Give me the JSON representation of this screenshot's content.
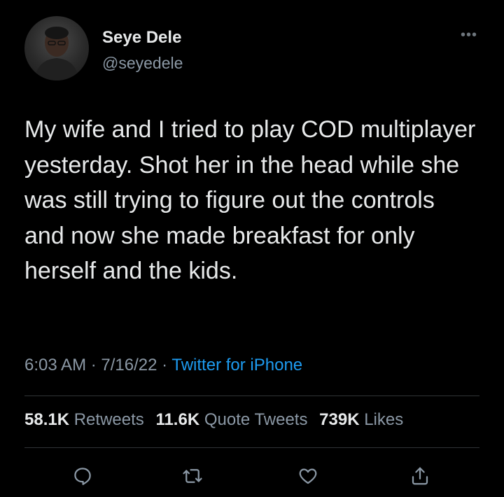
{
  "tweet": {
    "author": {
      "display_name": "Seye Dele",
      "handle": "@seyedele"
    },
    "text": "My wife and I tried to play COD multiplayer yesterday. Shot her in the head while she was still trying to figure out the controls and now she made breakfast for only herself and the kids.",
    "time": "6:03 AM",
    "date": "7/16/22",
    "separator": "·",
    "source": "Twitter for iPhone"
  },
  "stats": {
    "retweets": {
      "count": "58.1K",
      "label": "Retweets"
    },
    "quote_tweets": {
      "count": "11.6K",
      "label": "Quote Tweets"
    },
    "likes": {
      "count": "739K",
      "label": "Likes"
    }
  },
  "icons": {
    "more": "more-icon",
    "reply": "reply-icon",
    "retweet": "retweet-icon",
    "like": "heart-icon",
    "share": "share-icon"
  },
  "colors": {
    "background": "#000000",
    "text": "#e7e9ea",
    "secondary": "#8b98a5",
    "link": "#1d9bf0",
    "divider": "#2f3336"
  }
}
